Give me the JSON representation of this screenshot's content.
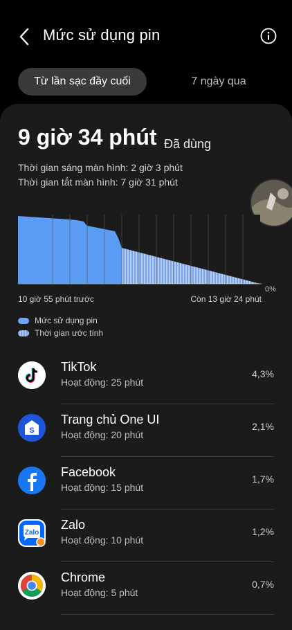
{
  "header": {
    "title": "Mức sử dụng pin",
    "back_icon": "back-arrow-icon",
    "info_icon": "info-icon"
  },
  "tabs": [
    {
      "label": "Từ lần sạc đầy cuối",
      "active": true
    },
    {
      "label": "7 ngày qua",
      "active": false
    }
  ],
  "summary": {
    "used_time": "9 giờ 34 phút",
    "used_label": "Đã dùng",
    "screen_on": "Thời gian sáng màn hình: 2 giờ 3 phút",
    "screen_off": "Thời gian tắt màn hình: 7 giờ 31 phút"
  },
  "chart": {
    "percent_label": "0%",
    "start_label": "10 giờ 55 phút trước",
    "end_label": "Còn 13 giờ 24 phút",
    "legend": [
      {
        "label": "Mức sử dụng pin",
        "style": "solid",
        "color": "#5b9cf5"
      },
      {
        "label": "Thời gian ước tính",
        "style": "striped",
        "color": "#7aa5e4"
      }
    ]
  },
  "chart_data": {
    "type": "area",
    "title": "",
    "xlabel": "",
    "ylabel": "",
    "ylim": [
      0,
      100
    ],
    "series": [
      {
        "name": "Mức sử dụng pin",
        "kind": "actual",
        "color": "#5b9cf5",
        "points": [
          [
            0,
            98
          ],
          [
            0.15,
            97
          ],
          [
            0.3,
            96
          ],
          [
            0.45,
            95
          ],
          [
            0.6,
            94
          ],
          [
            0.75,
            93
          ],
          [
            0.85,
            92
          ],
          [
            0.95,
            90
          ],
          [
            0.98,
            86
          ],
          [
            1,
            84
          ],
          [
            1.1,
            82
          ],
          [
            1.2,
            80
          ],
          [
            1.3,
            78
          ],
          [
            1.4,
            76
          ],
          [
            1.45,
            66
          ],
          [
            1.5,
            52
          ]
        ]
      },
      {
        "name": "Thời gian ước tính",
        "kind": "estimated",
        "color": "#7aa5e4",
        "points": [
          [
            1.5,
            52
          ],
          [
            3.5,
            0
          ]
        ]
      }
    ],
    "x_range": [
      0,
      3.5
    ]
  },
  "apps": [
    {
      "name": "TikTok",
      "sub": "Hoạt động: 25 phút",
      "pct": "4,3%",
      "icon": "tiktok-icon"
    },
    {
      "name": "Trang chủ One UI",
      "sub": "Hoạt động: 20 phút",
      "pct": "2,1%",
      "icon": "one-ui-home-icon"
    },
    {
      "name": "Facebook",
      "sub": "Hoạt động: 15 phút",
      "pct": "1,7%",
      "icon": "facebook-icon"
    },
    {
      "name": "Zalo",
      "sub": "Hoạt động: 10 phút",
      "pct": "1,2%",
      "icon": "zalo-icon"
    },
    {
      "name": "Chrome",
      "sub": "Hoạt động: 5 phút",
      "pct": "0,7%",
      "icon": "chrome-icon"
    }
  ],
  "colors": {
    "background": "#000000",
    "card": "#1b1b1b",
    "accent": "#5b9cf5"
  }
}
